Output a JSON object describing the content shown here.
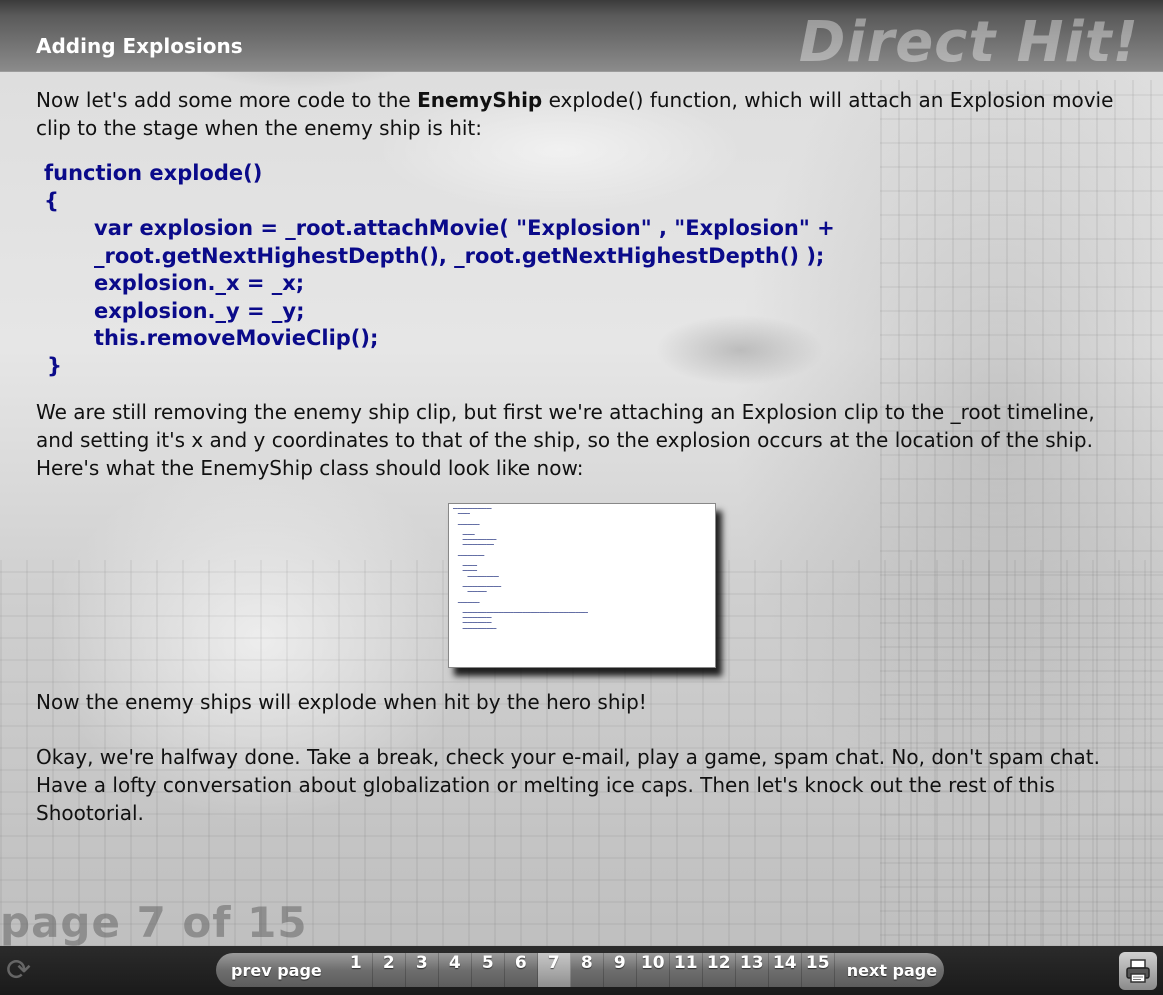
{
  "header": {
    "title": "Adding Explosions",
    "logo_text": "Direct Hit!"
  },
  "content": {
    "intro_before": "Now let's add some more code to the ",
    "intro_em": "EnemyShip",
    "intro_after": "  explode() function, which will attach an Explosion movie clip to the stage when the enemy ship is hit:",
    "code_lines": [
      "function explode()",
      "{",
      "var explosion = _root.attachMovie( \"Explosion\" , \"Explosion\" +",
      "_root.getNextHighestDepth(), _root.getNextHighestDepth() );",
      "explosion._x = _x;",
      "explosion._y = _y;",
      "this.removeMovieClip();",
      "}"
    ],
    "para2": "We are still removing the enemy ship clip, but first we're attaching an Explosion clip to the _root timeline, and setting it's x and y coordinates to that of the ship, so the explosion occurs at the location of the ship. Here's what the EnemyShip class should look like now:",
    "para3": "Now the enemy ships will explode when hit by the hero ship!",
    "para4": "Okay, we're halfway done. Take a break, check your e-mail, play a game, spam chat. No, don't spam chat. Have a lofty conversation about globalization or melting ice caps. Then let's knock out the rest of this Shootorial."
  },
  "footer": {
    "page_label": "page 7 of 15"
  },
  "nav": {
    "prev_label": "prev page",
    "next_label": "next page",
    "pages": [
      "1",
      "2",
      "3",
      "4",
      "5",
      "6",
      "7",
      "8",
      "9",
      "10",
      "11",
      "12",
      "13",
      "14",
      "15"
    ],
    "current_page": "7"
  },
  "colors": {
    "code": "#0a0a8a",
    "header_text": "#ffffff"
  }
}
